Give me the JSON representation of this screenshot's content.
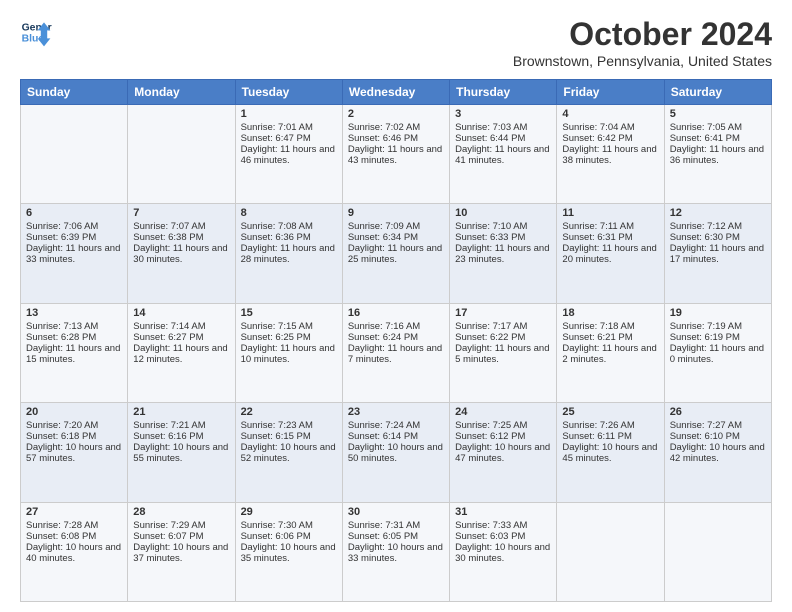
{
  "header": {
    "logo_line1": "General",
    "logo_line2": "Blue",
    "month_title": "October 2024",
    "location": "Brownstown, Pennsylvania, United States"
  },
  "days_of_week": [
    "Sunday",
    "Monday",
    "Tuesday",
    "Wednesday",
    "Thursday",
    "Friday",
    "Saturday"
  ],
  "weeks": [
    [
      {
        "day": "",
        "content": ""
      },
      {
        "day": "",
        "content": ""
      },
      {
        "day": "1",
        "content": "Sunrise: 7:01 AM\nSunset: 6:47 PM\nDaylight: 11 hours and 46 minutes."
      },
      {
        "day": "2",
        "content": "Sunrise: 7:02 AM\nSunset: 6:46 PM\nDaylight: 11 hours and 43 minutes."
      },
      {
        "day": "3",
        "content": "Sunrise: 7:03 AM\nSunset: 6:44 PM\nDaylight: 11 hours and 41 minutes."
      },
      {
        "day": "4",
        "content": "Sunrise: 7:04 AM\nSunset: 6:42 PM\nDaylight: 11 hours and 38 minutes."
      },
      {
        "day": "5",
        "content": "Sunrise: 7:05 AM\nSunset: 6:41 PM\nDaylight: 11 hours and 36 minutes."
      }
    ],
    [
      {
        "day": "6",
        "content": "Sunrise: 7:06 AM\nSunset: 6:39 PM\nDaylight: 11 hours and 33 minutes."
      },
      {
        "day": "7",
        "content": "Sunrise: 7:07 AM\nSunset: 6:38 PM\nDaylight: 11 hours and 30 minutes."
      },
      {
        "day": "8",
        "content": "Sunrise: 7:08 AM\nSunset: 6:36 PM\nDaylight: 11 hours and 28 minutes."
      },
      {
        "day": "9",
        "content": "Sunrise: 7:09 AM\nSunset: 6:34 PM\nDaylight: 11 hours and 25 minutes."
      },
      {
        "day": "10",
        "content": "Sunrise: 7:10 AM\nSunset: 6:33 PM\nDaylight: 11 hours and 23 minutes."
      },
      {
        "day": "11",
        "content": "Sunrise: 7:11 AM\nSunset: 6:31 PM\nDaylight: 11 hours and 20 minutes."
      },
      {
        "day": "12",
        "content": "Sunrise: 7:12 AM\nSunset: 6:30 PM\nDaylight: 11 hours and 17 minutes."
      }
    ],
    [
      {
        "day": "13",
        "content": "Sunrise: 7:13 AM\nSunset: 6:28 PM\nDaylight: 11 hours and 15 minutes."
      },
      {
        "day": "14",
        "content": "Sunrise: 7:14 AM\nSunset: 6:27 PM\nDaylight: 11 hours and 12 minutes."
      },
      {
        "day": "15",
        "content": "Sunrise: 7:15 AM\nSunset: 6:25 PM\nDaylight: 11 hours and 10 minutes."
      },
      {
        "day": "16",
        "content": "Sunrise: 7:16 AM\nSunset: 6:24 PM\nDaylight: 11 hours and 7 minutes."
      },
      {
        "day": "17",
        "content": "Sunrise: 7:17 AM\nSunset: 6:22 PM\nDaylight: 11 hours and 5 minutes."
      },
      {
        "day": "18",
        "content": "Sunrise: 7:18 AM\nSunset: 6:21 PM\nDaylight: 11 hours and 2 minutes."
      },
      {
        "day": "19",
        "content": "Sunrise: 7:19 AM\nSunset: 6:19 PM\nDaylight: 11 hours and 0 minutes."
      }
    ],
    [
      {
        "day": "20",
        "content": "Sunrise: 7:20 AM\nSunset: 6:18 PM\nDaylight: 10 hours and 57 minutes."
      },
      {
        "day": "21",
        "content": "Sunrise: 7:21 AM\nSunset: 6:16 PM\nDaylight: 10 hours and 55 minutes."
      },
      {
        "day": "22",
        "content": "Sunrise: 7:23 AM\nSunset: 6:15 PM\nDaylight: 10 hours and 52 minutes."
      },
      {
        "day": "23",
        "content": "Sunrise: 7:24 AM\nSunset: 6:14 PM\nDaylight: 10 hours and 50 minutes."
      },
      {
        "day": "24",
        "content": "Sunrise: 7:25 AM\nSunset: 6:12 PM\nDaylight: 10 hours and 47 minutes."
      },
      {
        "day": "25",
        "content": "Sunrise: 7:26 AM\nSunset: 6:11 PM\nDaylight: 10 hours and 45 minutes."
      },
      {
        "day": "26",
        "content": "Sunrise: 7:27 AM\nSunset: 6:10 PM\nDaylight: 10 hours and 42 minutes."
      }
    ],
    [
      {
        "day": "27",
        "content": "Sunrise: 7:28 AM\nSunset: 6:08 PM\nDaylight: 10 hours and 40 minutes."
      },
      {
        "day": "28",
        "content": "Sunrise: 7:29 AM\nSunset: 6:07 PM\nDaylight: 10 hours and 37 minutes."
      },
      {
        "day": "29",
        "content": "Sunrise: 7:30 AM\nSunset: 6:06 PM\nDaylight: 10 hours and 35 minutes."
      },
      {
        "day": "30",
        "content": "Sunrise: 7:31 AM\nSunset: 6:05 PM\nDaylight: 10 hours and 33 minutes."
      },
      {
        "day": "31",
        "content": "Sunrise: 7:33 AM\nSunset: 6:03 PM\nDaylight: 10 hours and 30 minutes."
      },
      {
        "day": "",
        "content": ""
      },
      {
        "day": "",
        "content": ""
      }
    ]
  ]
}
